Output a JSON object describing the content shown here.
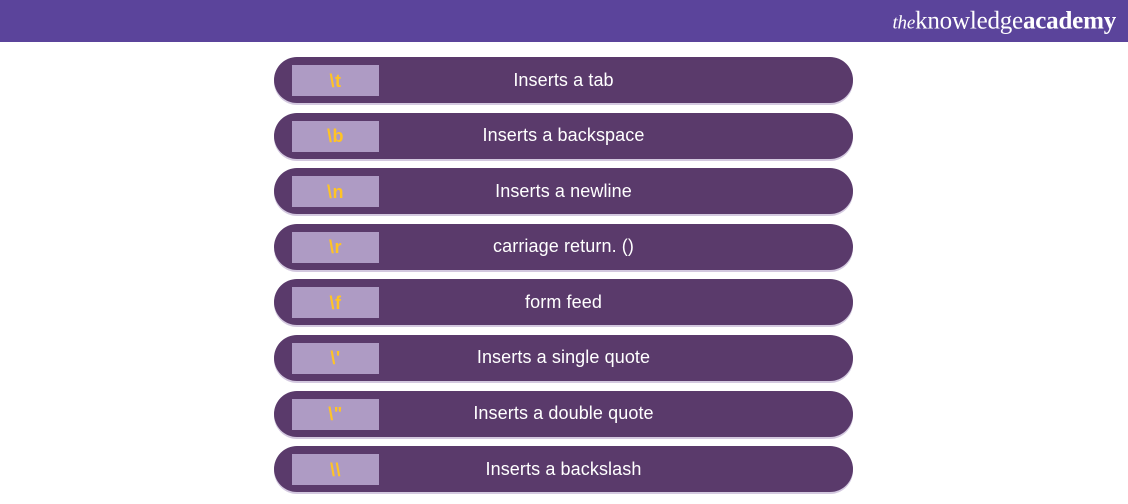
{
  "brand": {
    "logo_the": "the",
    "logo_knowledge": "knowledge",
    "logo_academy": "academy",
    "banner_color": "#5B449B"
  },
  "colors": {
    "banner": "#5B449B",
    "row_background": "#5A3A6B",
    "code_chip": "#AE9BC4",
    "code_text": "#FFC425",
    "description_text": "#FFFFFF",
    "page_background": "#FFFFFF"
  },
  "rows": [
    {
      "code": "\\t",
      "description": "Inserts a tab"
    },
    {
      "code": "\\b",
      "description": "Inserts a backspace"
    },
    {
      "code": "\\n",
      "description": "Inserts a newline"
    },
    {
      "code": "\\r",
      "description": "carriage return. ()"
    },
    {
      "code": "\\f",
      "description": "form feed"
    },
    {
      "code": "\\'",
      "description": "Inserts a single quote"
    },
    {
      "code": "\\\"",
      "description": "Inserts a double quote"
    },
    {
      "code": "\\\\",
      "description": "Inserts a backslash"
    }
  ]
}
